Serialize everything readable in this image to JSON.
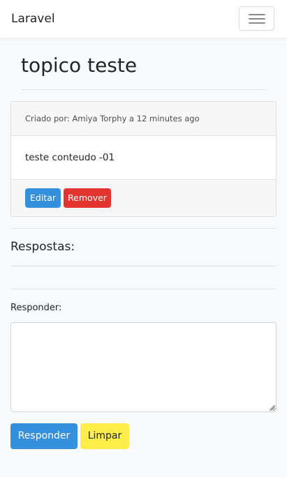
{
  "navbar": {
    "brand": "Laravel",
    "toggle_icon": "hamburger-menu-icon"
  },
  "topic": {
    "title": "topico teste",
    "meta": "Criado por: Amiya Torphy a 12 minutes ago",
    "content": "teste conteudo -01",
    "edit_label": "Editar",
    "remove_label": "Remover"
  },
  "replies": {
    "heading": "Respostas:"
  },
  "reply_form": {
    "label": "Responder:",
    "textarea_value": "",
    "textarea_placeholder": "",
    "submit_label": "Responder",
    "clear_label": "Limpar"
  },
  "colors": {
    "primary": "#3490dc",
    "danger": "#e3342f",
    "warning": "#ffed4a",
    "page_background": "#f8fafc"
  }
}
